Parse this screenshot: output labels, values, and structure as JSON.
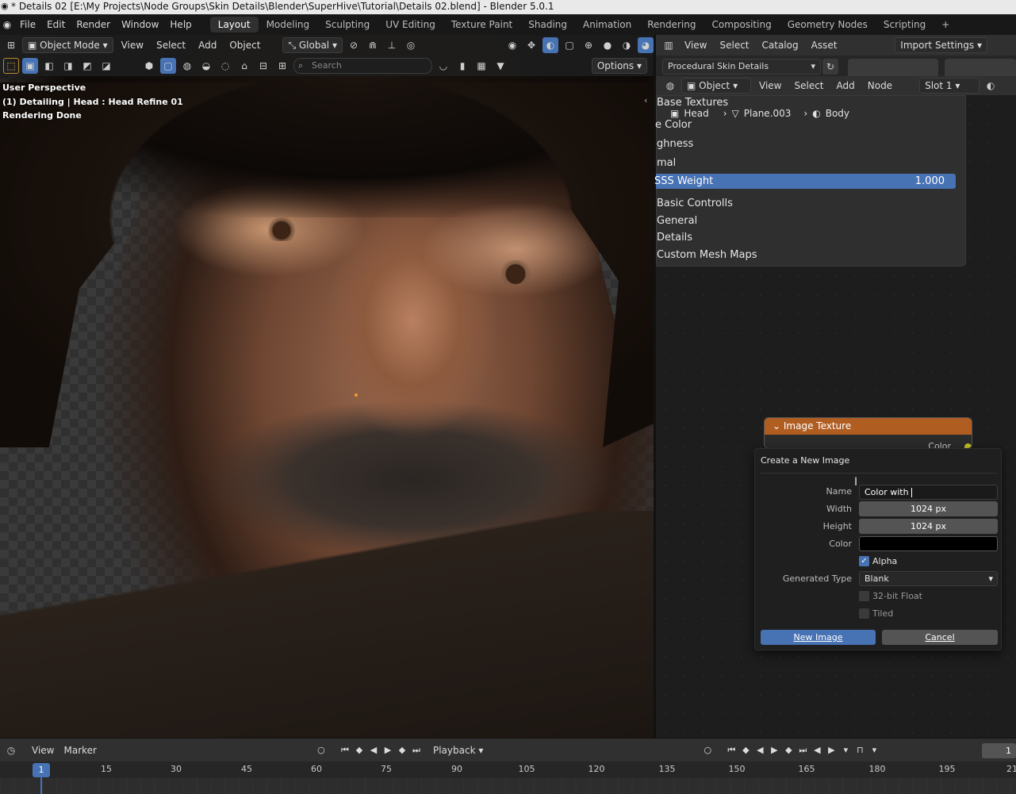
{
  "window": {
    "title": "* Details 02 [E:\\My Projects\\Node Groups\\Skin Details\\Blender\\SuperHive\\Tutorial\\Details 02.blend] - Blender 5.0.1"
  },
  "menu": [
    "File",
    "Edit",
    "Render",
    "Window",
    "Help"
  ],
  "workspaces": [
    "Layout",
    "Modeling",
    "Sculpting",
    "UV Editing",
    "Texture Paint",
    "Shading",
    "Animation",
    "Rendering",
    "Compositing",
    "Geometry Nodes",
    "Scripting",
    "+"
  ],
  "active_workspace": "Layout",
  "viewport": {
    "mode": "Object Mode",
    "menus": [
      "View",
      "Select",
      "Add",
      "Object"
    ],
    "orientation": "Global",
    "search_placeholder": "Search",
    "options_label": "Options",
    "info_line1": "User Perspective",
    "info_line2": "(1) Detailing | Head : Head Refine 01",
    "info_line3": "Rendering Done"
  },
  "asset_browser": {
    "menus": [
      "View",
      "Select",
      "Catalog",
      "Asset"
    ],
    "import_settings": "Import Settings",
    "library": "Procedural Skin Details"
  },
  "node_editor": {
    "object_select": "Object",
    "menus": [
      "View",
      "Select",
      "Add",
      "Node"
    ],
    "slot": "Slot 1",
    "breadcrumb": [
      "Head",
      "Plane.003",
      "Body"
    ]
  },
  "group_panel": {
    "items": [
      "Base Textures",
      "e Color",
      "ghness",
      "mal"
    ],
    "sss_label": "SSS Weight",
    "sss_value": "1.000",
    "sections": [
      "Basic Controlls",
      "General",
      "Details",
      "Custom Mesh Maps"
    ]
  },
  "image_node": {
    "title": "Image Texture",
    "socket": "Color"
  },
  "popup": {
    "title": "Create a New Image",
    "name_label": "Name",
    "name_value": "Color with",
    "width_label": "Width",
    "width_value": "1024 px",
    "height_label": "Height",
    "height_value": "1024 px",
    "color_label": "Color",
    "color_value": "#000000",
    "alpha_label": "Alpha",
    "alpha_checked": true,
    "generated_type_label": "Generated Type",
    "generated_type_value": "Blank",
    "float_label": "32-bit Float",
    "float_checked": false,
    "tiled_label": "Tiled",
    "tiled_checked": false,
    "ok_label": "New Image",
    "cancel_label": "Cancel"
  },
  "timeline": {
    "menus": [
      "View",
      "Marker"
    ],
    "playback": "Playback",
    "current_frame": "1",
    "ruler": [
      "1",
      "15",
      "30",
      "45",
      "60",
      "75",
      "90",
      "105",
      "120",
      "135",
      "150",
      "165",
      "180",
      "195",
      "21"
    ],
    "frame_field": "1"
  },
  "colors": {
    "accent": "#4772b3",
    "node_header": "#b05d22"
  }
}
